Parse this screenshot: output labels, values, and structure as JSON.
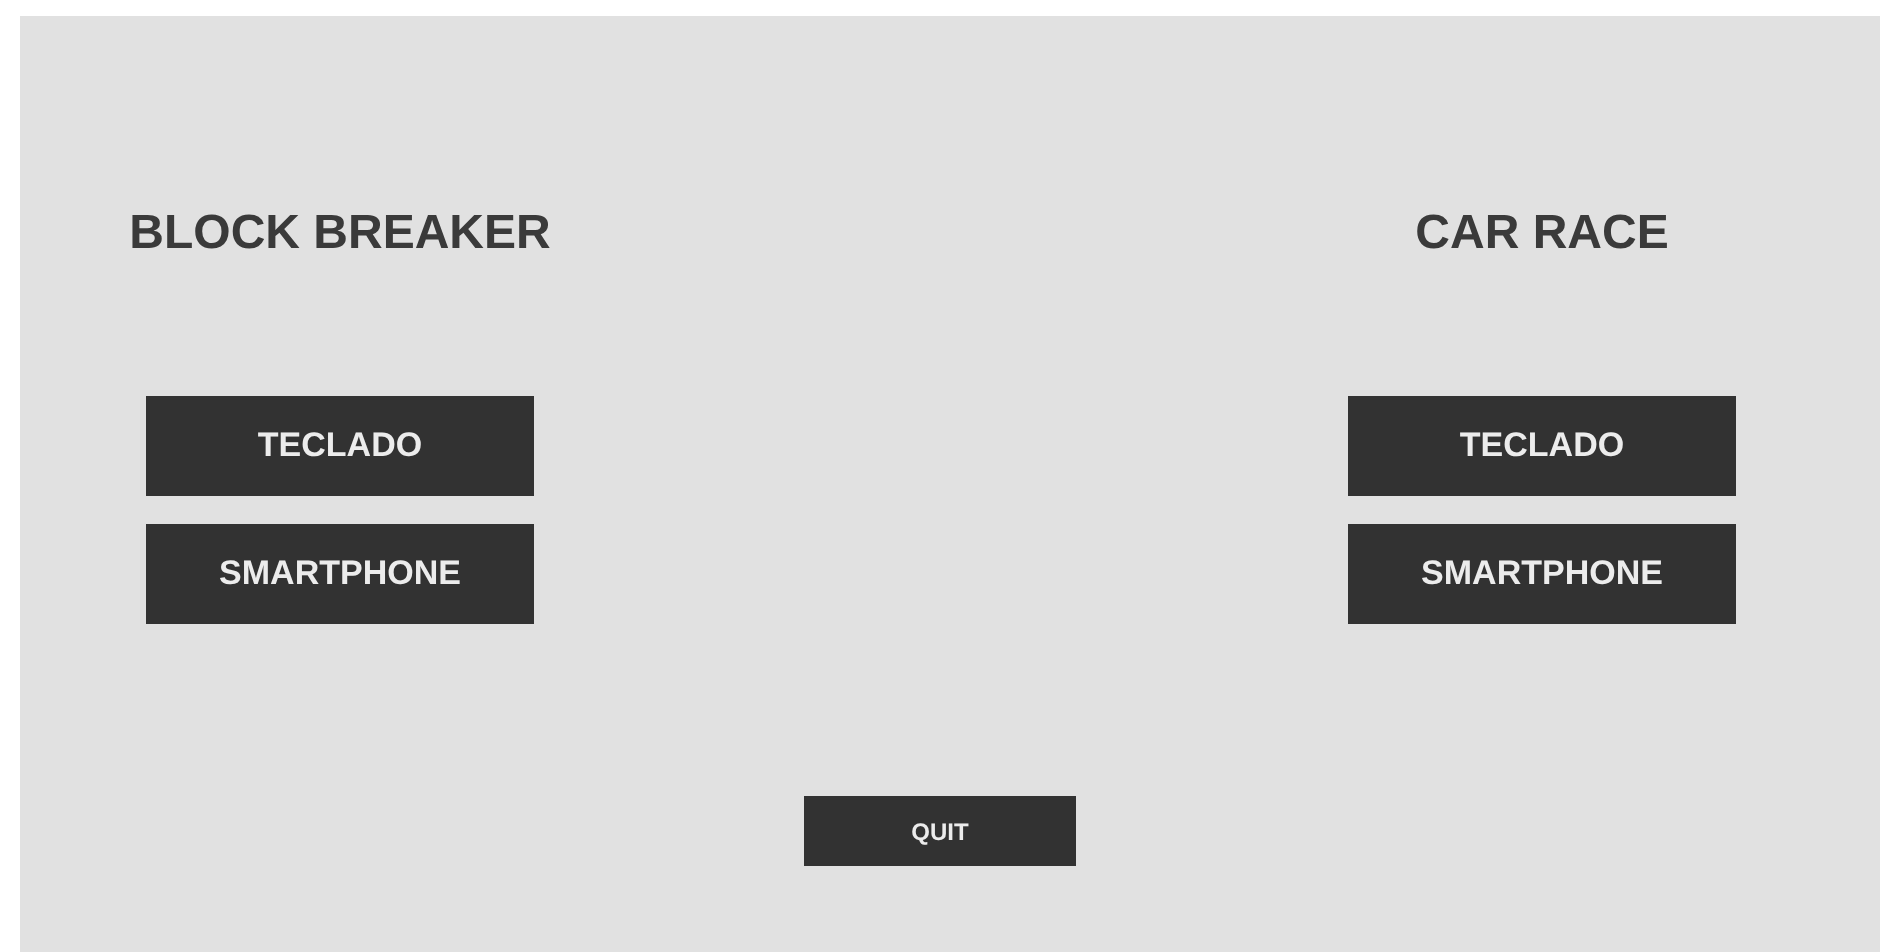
{
  "games": [
    {
      "title": "BLOCK BREAKER",
      "buttons": [
        "TECLADO",
        "SMARTPHONE"
      ]
    },
    {
      "title": "CAR RACE",
      "buttons": [
        "TECLADO",
        "SMARTPHONE"
      ]
    }
  ],
  "quit_button": "QUIT"
}
